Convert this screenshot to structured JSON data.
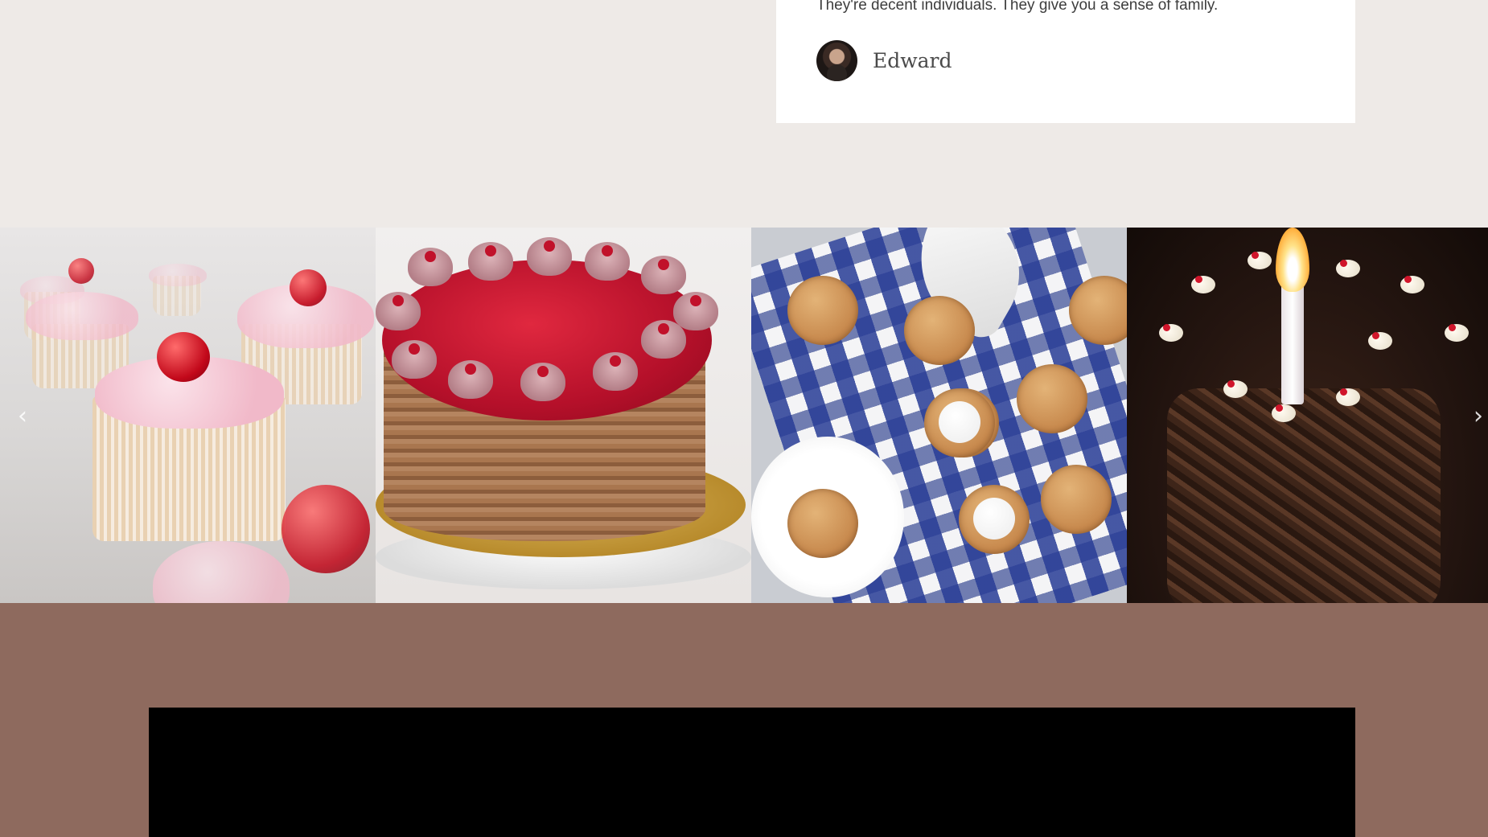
{
  "testimonial": {
    "quote": "They're decent individuals. They give you a sense of family.",
    "author_name": "Edward"
  },
  "gallery": {
    "images": [
      {
        "label": "cupcakes-photo"
      },
      {
        "label": "cheesecake-photo"
      },
      {
        "label": "oatmeal-cookies-photo"
      },
      {
        "label": "chocolate-birthday-cake-photo"
      }
    ],
    "prev_label": "‹",
    "next_label": "›"
  },
  "colors": {
    "page_bg": "#eeeae7",
    "card_bg": "#ffffff",
    "bottom_bg": "#8e6a5e",
    "video_bg": "#000000"
  },
  "icons": [
    "chevron-left-icon",
    "chevron-right-icon"
  ]
}
